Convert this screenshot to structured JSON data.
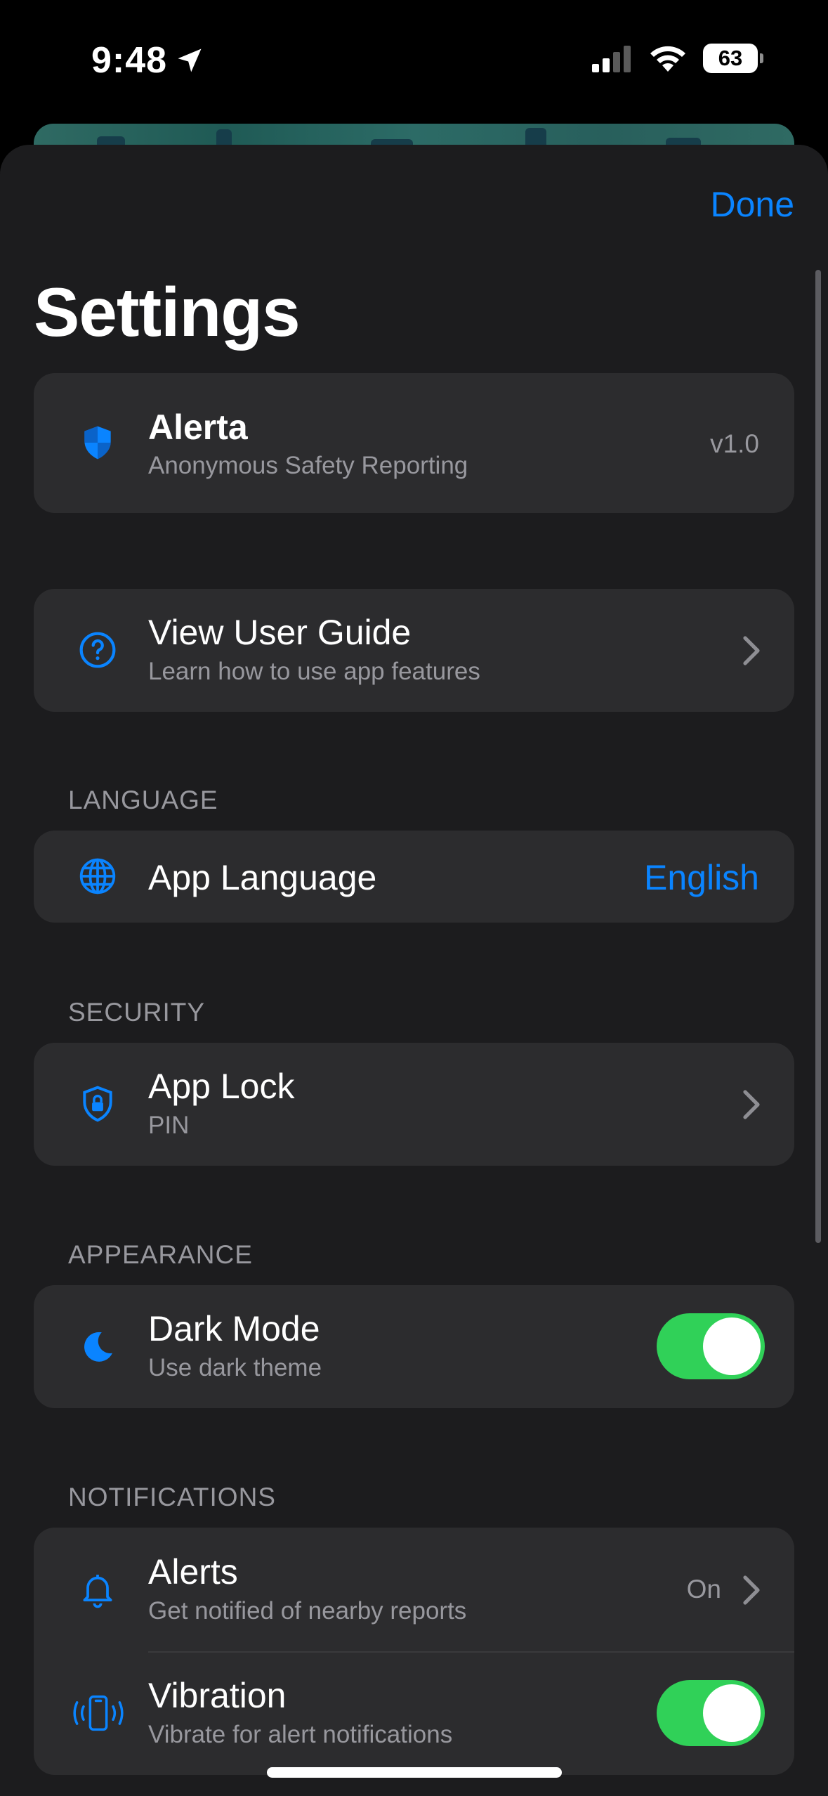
{
  "status_bar": {
    "time": "9:48",
    "battery": "63"
  },
  "header": {
    "done_label": "Done",
    "title": "Settings"
  },
  "app_card": {
    "name": "Alerta",
    "tagline": "Anonymous Safety Reporting",
    "version": "v1.0"
  },
  "guide": {
    "title": "View User Guide",
    "subtitle": "Learn how to use app features"
  },
  "language": {
    "section": "LANGUAGE",
    "label": "App Language",
    "value": "English"
  },
  "security": {
    "section": "SECURITY",
    "title": "App Lock",
    "subtitle": "PIN"
  },
  "appearance": {
    "section": "APPEARANCE",
    "title": "Dark Mode",
    "subtitle": "Use dark theme",
    "enabled": true
  },
  "notifications": {
    "section": "NOTIFICATIONS",
    "alerts": {
      "title": "Alerts",
      "subtitle": "Get notified of nearby reports",
      "value": "On"
    },
    "vibration": {
      "title": "Vibration",
      "subtitle": "Vibrate for alert notifications",
      "enabled": true
    }
  },
  "colors": {
    "accent": "#0a84ff",
    "toggle_on": "#30d158",
    "card": "#2c2c2e",
    "sheet": "#1c1c1e"
  },
  "icons": [
    "location-arrow-icon",
    "signal-icon",
    "wifi-icon",
    "shield-icon",
    "question-circle-icon",
    "globe-icon",
    "lock-shield-icon",
    "moon-icon",
    "bell-icon",
    "phone-vibrate-icon",
    "chevron-right-icon"
  ]
}
